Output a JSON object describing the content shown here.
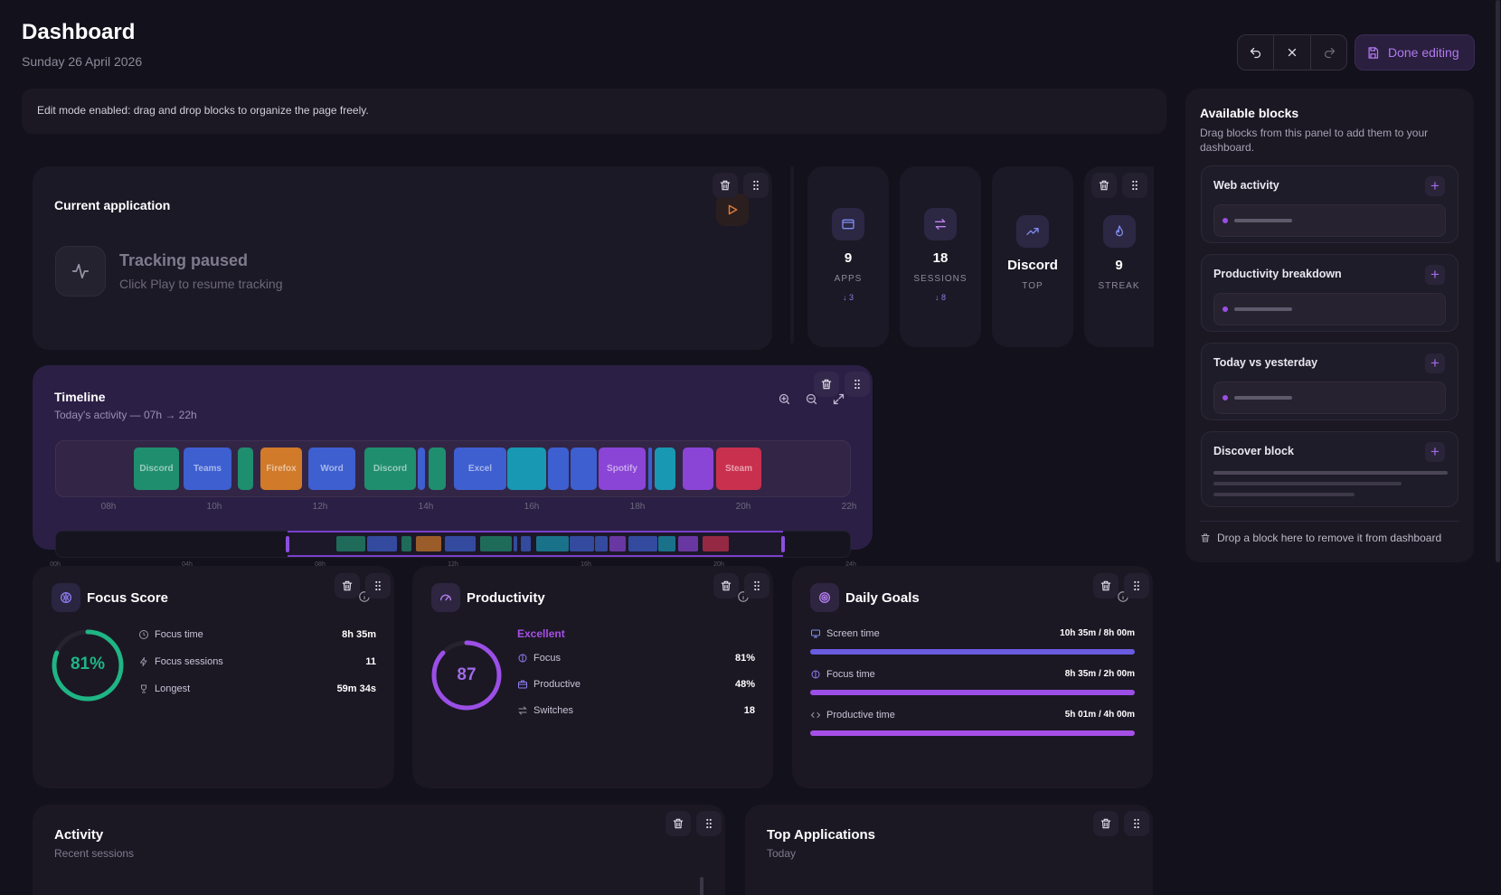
{
  "header": {
    "title": "Dashboard",
    "date": "Sunday 26 April 2026",
    "done_label": "Done editing"
  },
  "banner": {
    "text": "Edit mode enabled: drag and drop blocks to organize the page freely."
  },
  "current_app": {
    "title": "Current application",
    "status": "Tracking paused",
    "hint": "Click Play to resume tracking"
  },
  "stats": [
    {
      "value": "9",
      "label": "APPS",
      "delta": "↓ 3",
      "icon": "window-icon"
    },
    {
      "value": "18",
      "label": "SESSIONS",
      "delta": "↓ 8",
      "icon": "switch-icon"
    },
    {
      "value": "Discord",
      "label": "TOP",
      "delta": "",
      "icon": "trend-up-icon"
    },
    {
      "value": "9",
      "label": "STREAK",
      "delta": "",
      "icon": "flame-icon"
    }
  ],
  "timeline": {
    "title": "Timeline",
    "subtitle": "Today's activity — 07h → 22h",
    "ticks": [
      "08h",
      "10h",
      "12h",
      "14h",
      "16h",
      "18h",
      "20h",
      "22h"
    ],
    "overview_ticks": [
      "00h",
      "04h",
      "08h",
      "12h",
      "16h",
      "20h",
      "24h"
    ],
    "segments": [
      {
        "label": "Discord",
        "color": "#1f8e6e"
      },
      {
        "label": "Teams",
        "color": "#3d5fd0"
      },
      {
        "label": "",
        "color": "#1f8e6e"
      },
      {
        "label": "Firefox",
        "color": "#d07a2a"
      },
      {
        "label": "Word",
        "color": "#3d5fd0"
      },
      {
        "label": "Discord",
        "color": "#1f8e6e"
      },
      {
        "label": "",
        "color": "#3d5fd0"
      },
      {
        "label": "",
        "color": "#1f8e6e"
      },
      {
        "label": "Excel",
        "color": "#3d5fd0"
      },
      {
        "label": "",
        "color": "#1898b2"
      },
      {
        "label": "",
        "color": "#3d5fd0"
      },
      {
        "label": "",
        "color": "#3d5fd0"
      },
      {
        "label": "Spotify",
        "color": "#8a44d6"
      },
      {
        "label": "",
        "color": "#3d5fd0"
      },
      {
        "label": "",
        "color": "#1898b2"
      },
      {
        "label": "",
        "color": "#8a44d6"
      },
      {
        "label": "Steam",
        "color": "#c9304e"
      }
    ]
  },
  "focus": {
    "title": "Focus Score",
    "score": "81%",
    "score_value": 81,
    "rows": [
      {
        "label": "Focus time",
        "value": "8h 35m"
      },
      {
        "label": "Focus sessions",
        "value": "11"
      },
      {
        "label": "Longest",
        "value": "59m 34s"
      }
    ]
  },
  "productivity": {
    "title": "Productivity",
    "score": "87",
    "score_value": 87,
    "rating": "Excellent",
    "rows": [
      {
        "label": "Focus",
        "value": "81%"
      },
      {
        "label": "Productive",
        "value": "48%"
      },
      {
        "label": "Switches",
        "value": "18"
      }
    ]
  },
  "goals": {
    "title": "Daily Goals",
    "rows": [
      {
        "label": "Screen time",
        "value": "10h 35m / 8h 00m",
        "progress": 1.0,
        "color": "#6a5ce0"
      },
      {
        "label": "Focus time",
        "value": "8h 35m / 2h 00m",
        "progress": 1.0,
        "color": "#9b4fe6"
      },
      {
        "label": "Productive time",
        "value": "5h 01m / 4h 00m",
        "progress": 1.0,
        "color": "#a64fe6"
      }
    ]
  },
  "activity": {
    "title": "Activity",
    "subtitle": "Recent sessions"
  },
  "top_apps": {
    "title": "Top Applications",
    "subtitle": "Today"
  },
  "sidebar": {
    "title": "Available blocks",
    "subtitle": "Drag blocks from this panel to add them to your dashboard.",
    "blocks": [
      "Web activity",
      "Productivity breakdown",
      "Today vs yesterday",
      "Discover block"
    ],
    "drop_hint": "Drop a block here to remove it from dashboard"
  }
}
